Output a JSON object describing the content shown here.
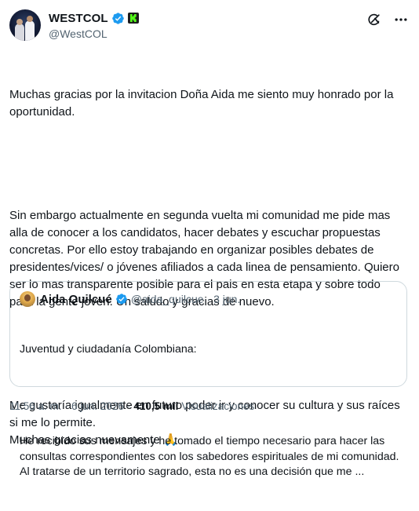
{
  "author": {
    "display_name": "WESTCOL",
    "handle": "@WestCOL"
  },
  "header_icons": [
    "grok-icon",
    "more-icon"
  ],
  "tweet": {
    "paragraphs": [
      "Muchas gracias por la invitacion Doña Aida me siento muy honrado por la oportunidad.",
      "Sin embargo actualmente en segunda vuelta mi comunidad me pide mas alla de conocer a los candidatos, hacer debates y escuchar propuestas concretas. Por ello estoy trabajando en organizar posibles debates de presidentes/vices/ o jóvenes afiliados a cada linea de pensamiento. Quiero ser lo mas transparente posible para el pais en esta etapa y sobre todo para la gente joven. Un saludo y gracias de nuevo.",
      "Me gustaría igualmente en futuro poder ir y conocer su cultura y sus raíces si me lo permite.\nMuchas gracias nuevamente 🙏"
    ]
  },
  "quote": {
    "display_name": "Aida Quilcué",
    "handle": "@aida_quilcue",
    "date": "· 3 jun.",
    "line1": "Juventud y ciudadanía Colombiana:",
    "line2": "He recibido sus mensajes y he tomado el tiempo necesario para hacer las consultas correspondientes con los sabedores espirituales de mi comunidad. Al tratarse de un territorio sagrado, esta no es una decisión que me ..."
  },
  "footer": {
    "time": "11:56 a. m.",
    "date": "6 jun. 2026",
    "views_count": "410,5 mil",
    "views_label": "Visualizaciones"
  },
  "colors": {
    "verified": "#1d9bf0",
    "kick_green": "#53fc18",
    "secondary_text": "#536471",
    "border": "#cfd9de"
  }
}
